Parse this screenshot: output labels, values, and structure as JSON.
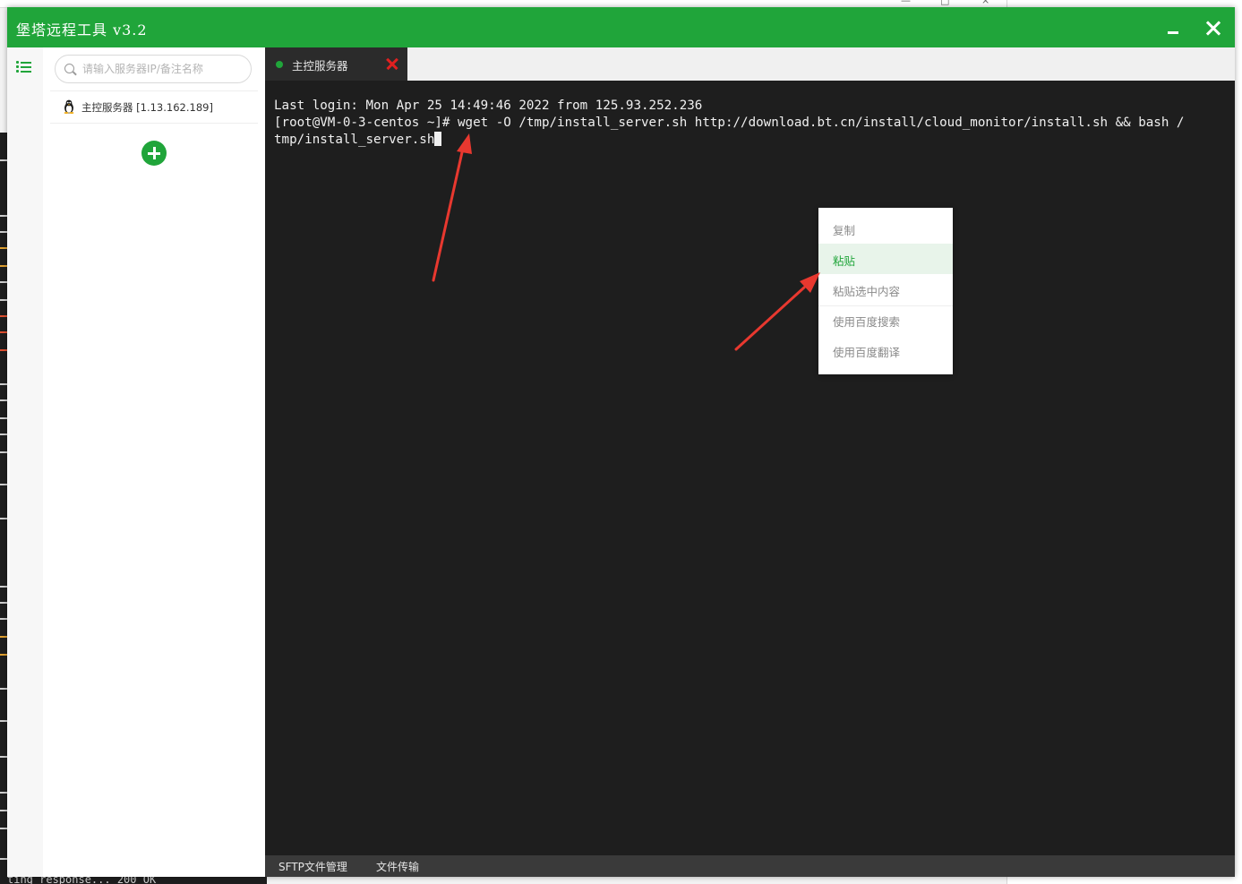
{
  "app": {
    "title": "堡塔远程工具 v3.2",
    "accent_color": "#20a53a"
  },
  "sidebar": {
    "menu_icon": "list-icon",
    "search_placeholder": "请输入服务器IP/备注名称",
    "servers": [
      {
        "icon": "linux-penguin-icon",
        "label": "主控服务器 [1.13.162.189]"
      }
    ],
    "add_icon": "plus-circle-icon"
  },
  "tabs": [
    {
      "label": "主控服务器",
      "status": "connected",
      "close_icon": "close-x-icon"
    }
  ],
  "terminal": {
    "lines": [
      "Last login: Mon Apr 25 14:49:46 2022 from 125.93.252.236",
      "[root@VM-0-3-centos ~]# wget -O /tmp/install_server.sh http://download.bt.cn/install/cloud_monitor/install.sh && bash /",
      "tmp/install_server.sh"
    ]
  },
  "context_menu": {
    "items": [
      {
        "label": "复制",
        "active": false
      },
      {
        "label": "粘贴",
        "active": true
      },
      {
        "label": "粘贴选中内容",
        "active": false
      },
      {
        "label": "使用百度搜索",
        "active": false
      },
      {
        "label": "使用百度翻译",
        "active": false
      }
    ]
  },
  "bottom_bar": {
    "sftp_label": "SFTP文件管理",
    "transfer_label": "文件传输"
  },
  "background": {
    "bottom_text": "ting response... 200 OK"
  },
  "annotations": {
    "arrow_color": "#e8382f"
  }
}
